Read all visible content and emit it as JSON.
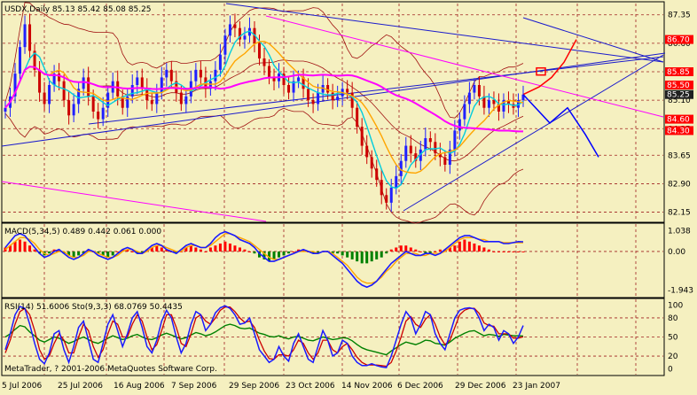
{
  "colors": {
    "chart_bg": "#f5f0c0",
    "bull": "#2020ff",
    "bear": "#cc0000",
    "ma_fast": "#00ccdd",
    "ma_mid": "#ffa500",
    "ma_slow": "#ff00ff",
    "band": "#a01010",
    "trend": "#1a1acc",
    "channel": "#ff00ff",
    "grid": "#a02020",
    "label_red_bg": "#ff0000",
    "label_white": "#ffffff",
    "macd_up": "#ff0000",
    "macd_down": "#008000",
    "rsi": "#008000",
    "stoch_main": "#1a1aff",
    "stoch_signal": "#cc0000",
    "arrows": "#ff0000",
    "arrows_alt": "#0000ff"
  },
  "chart_data": [
    {
      "type": "candlestick",
      "title": "USDX,Daily  85.13 85.42 85.08 85.25",
      "symbol": "USDX",
      "timeframe": "Daily",
      "ohlc_last": {
        "open": 85.13,
        "high": 85.42,
        "low": 85.08,
        "close": 85.25
      },
      "price_ticks": [
        "87.35",
        "86.60",
        "85.85",
        "85.10",
        "84.35",
        "83.65",
        "82.90",
        "82.15"
      ],
      "price_labels": [
        {
          "value": 86.7,
          "text": "86.70",
          "style": "red"
        },
        {
          "value": 85.85,
          "text": "85.85",
          "style": "red"
        },
        {
          "value": 85.5,
          "text": "85.50",
          "style": "red"
        },
        {
          "value": 85.25,
          "text": "85.25",
          "style": "dark"
        },
        {
          "value": 84.6,
          "text": "84.60",
          "style": "red"
        },
        {
          "value": 84.3,
          "text": "84.30",
          "style": "red"
        }
      ],
      "ylim": [
        82.0,
        87.6
      ],
      "date_labels": [
        "5 Jul 2006",
        "25 Jul 2006",
        "16 Aug 2006",
        "7 Sep 2006",
        "29 Sep 2006",
        "23 Oct 2006",
        "14 Nov 2006",
        "6 Dec 2006",
        "29 Dec 2006",
        "23 Jan 2007"
      ],
      "close_series_approx": [
        84.9,
        85.2,
        85.8,
        86.5,
        87.1,
        86.4,
        85.9,
        85.3,
        85.0,
        85.5,
        85.8,
        85.6,
        85.1,
        84.7,
        85.0,
        85.4,
        85.7,
        85.2,
        84.8,
        84.6,
        84.9,
        85.3,
        85.6,
        85.2,
        84.9,
        85.2,
        85.5,
        85.7,
        85.4,
        85.1,
        85.0,
        85.3,
        85.7,
        85.9,
        85.6,
        85.3,
        85.0,
        85.2,
        85.6,
        85.9,
        85.7,
        85.4,
        85.6,
        85.9,
        86.3,
        86.8,
        87.1,
        87.0,
        86.7,
        86.8,
        87.0,
        86.6,
        86.2,
        86.0,
        85.7,
        85.6,
        85.8,
        85.5,
        85.3,
        85.6,
        85.7,
        85.4,
        85.1,
        85.0,
        85.3,
        85.5,
        85.3,
        85.1,
        85.2,
        85.4,
        85.3,
        84.9,
        84.4,
        83.9,
        83.6,
        83.3,
        83.0,
        82.6,
        82.4,
        82.8,
        83.1,
        83.5,
        83.9,
        83.7,
        83.5,
        83.8,
        84.1,
        84.0,
        83.7,
        83.6,
        83.4,
        83.8,
        84.3,
        84.6,
        85.0,
        85.3,
        85.5,
        85.2,
        84.9,
        85.1,
        85.0,
        84.8,
        85.1,
        85.0,
        84.9,
        85.1,
        85.25
      ],
      "projection": [
        85.25,
        85.45,
        85.7,
        86.1,
        86.7
      ],
      "projection_alt": [
        85.25,
        84.5,
        84.9,
        84.2,
        83.6
      ]
    },
    {
      "type": "bar",
      "title": "MACD(5,34,5)  0.489 0.442 0.061 0.000",
      "y_ticks": [
        "1.038",
        "0.00",
        "-1.943"
      ],
      "ylim": [
        -2.15,
        1.25
      ],
      "histogram": [
        0.2,
        0.3,
        0.5,
        0.6,
        0.5,
        0.3,
        0.1,
        -0.1,
        -0.2,
        -0.1,
        0.1,
        0.1,
        -0.1,
        -0.2,
        -0.3,
        -0.2,
        -0.1,
        0.1,
        0.0,
        -0.1,
        -0.2,
        -0.3,
        -0.2,
        0.0,
        0.1,
        0.1,
        0.0,
        -0.1,
        -0.1,
        0.1,
        0.2,
        0.3,
        0.2,
        0.1,
        0.0,
        -0.1,
        0.0,
        0.2,
        0.3,
        0.2,
        0.1,
        0.0,
        0.2,
        0.3,
        0.4,
        0.5,
        0.4,
        0.3,
        0.2,
        0.1,
        0.0,
        -0.1,
        -0.3,
        -0.4,
        -0.5,
        -0.4,
        -0.3,
        -0.2,
        -0.1,
        0.0,
        0.1,
        0.1,
        0.0,
        -0.1,
        -0.1,
        0.0,
        0.0,
        -0.1,
        -0.1,
        -0.2,
        -0.3,
        -0.4,
        -0.5,
        -0.6,
        -0.6,
        -0.5,
        -0.4,
        -0.3,
        -0.1,
        0.1,
        0.2,
        0.3,
        0.3,
        0.2,
        0.1,
        0.0,
        -0.1,
        -0.1,
        0.0,
        0.1,
        0.1,
        0.2,
        0.3,
        0.5,
        0.6,
        0.5,
        0.4,
        0.3,
        0.2,
        0.1,
        0.0,
        0.0,
        0.0,
        0.0,
        0.0,
        0.0,
        0.0
      ],
      "macd_line": [
        0.2,
        0.5,
        0.8,
        0.9,
        0.8,
        0.5,
        0.2,
        -0.1,
        -0.3,
        -0.2,
        0.0,
        0.1,
        -0.1,
        -0.3,
        -0.4,
        -0.3,
        -0.1,
        0.1,
        0.0,
        -0.2,
        -0.3,
        -0.4,
        -0.3,
        -0.1,
        0.1,
        0.2,
        0.1,
        -0.1,
        -0.1,
        0.1,
        0.3,
        0.4,
        0.3,
        0.1,
        0.0,
        -0.1,
        0.1,
        0.3,
        0.4,
        0.3,
        0.2,
        0.2,
        0.4,
        0.7,
        0.9,
        1.0,
        0.9,
        0.8,
        0.6,
        0.5,
        0.4,
        0.2,
        -0.1,
        -0.3,
        -0.5,
        -0.5,
        -0.4,
        -0.3,
        -0.2,
        -0.1,
        0.0,
        0.1,
        0.0,
        -0.1,
        -0.1,
        0.0,
        0.0,
        -0.2,
        -0.4,
        -0.6,
        -0.9,
        -1.2,
        -1.5,
        -1.7,
        -1.8,
        -1.7,
        -1.5,
        -1.2,
        -0.9,
        -0.6,
        -0.4,
        -0.2,
        0.0,
        -0.1,
        -0.2,
        -0.2,
        -0.1,
        -0.1,
        -0.2,
        -0.1,
        0.1,
        0.3,
        0.5,
        0.7,
        0.8,
        0.8,
        0.7,
        0.6,
        0.5,
        0.5,
        0.5,
        0.5,
        0.4,
        0.4,
        0.45,
        0.5,
        0.489
      ],
      "signal_line": [
        0.1,
        0.3,
        0.5,
        0.7,
        0.7,
        0.6,
        0.4,
        0.1,
        -0.1,
        -0.2,
        -0.1,
        0.0,
        0.0,
        -0.2,
        -0.3,
        -0.3,
        -0.2,
        0.0,
        0.0,
        -0.1,
        -0.2,
        -0.3,
        -0.3,
        -0.2,
        0.0,
        0.1,
        0.1,
        0.0,
        -0.1,
        0.0,
        0.2,
        0.3,
        0.3,
        0.2,
        0.1,
        0.0,
        0.0,
        0.2,
        0.3,
        0.3,
        0.2,
        0.2,
        0.3,
        0.5,
        0.7,
        0.9,
        0.9,
        0.8,
        0.7,
        0.6,
        0.5,
        0.3,
        0.1,
        -0.1,
        -0.3,
        -0.4,
        -0.4,
        -0.3,
        -0.2,
        -0.1,
        0.0,
        0.0,
        0.0,
        0.0,
        -0.1,
        0.0,
        0.0,
        -0.1,
        -0.3,
        -0.5,
        -0.7,
        -1.0,
        -1.3,
        -1.5,
        -1.6,
        -1.6,
        -1.5,
        -1.3,
        -1.0,
        -0.8,
        -0.5,
        -0.3,
        -0.1,
        -0.1,
        -0.1,
        -0.2,
        -0.2,
        -0.1,
        -0.1,
        -0.1,
        0.0,
        0.2,
        0.4,
        0.6,
        0.7,
        0.7,
        0.7,
        0.6,
        0.6,
        0.5,
        0.5,
        0.5,
        0.45,
        0.45,
        0.44,
        0.44,
        0.442
      ]
    },
    {
      "type": "line",
      "title": "RSI(14) 51.6006  Sto(9,3,3) 68.0769 50.4435",
      "y_ticks": [
        "100",
        "80",
        "50",
        "20",
        "0"
      ],
      "ylim": [
        -5,
        105
      ],
      "rsi": [
        50,
        55,
        62,
        68,
        66,
        58,
        52,
        45,
        42,
        46,
        50,
        48,
        44,
        40,
        43,
        47,
        50,
        46,
        42,
        40,
        44,
        48,
        52,
        49,
        46,
        48,
        52,
        54,
        50,
        47,
        46,
        49,
        53,
        56,
        53,
        50,
        47,
        49,
        53,
        57,
        55,
        52,
        54,
        58,
        63,
        68,
        70,
        68,
        64,
        63,
        64,
        60,
        56,
        54,
        51,
        50,
        52,
        49,
        47,
        50,
        51,
        48,
        45,
        44,
        47,
        50,
        48,
        46,
        47,
        49,
        48,
        44,
        38,
        33,
        30,
        28,
        26,
        24,
        22,
        28,
        33,
        38,
        42,
        40,
        38,
        41,
        45,
        44,
        40,
        39,
        37,
        42,
        48,
        52,
        56,
        59,
        60,
        56,
        52,
        54,
        53,
        51,
        54,
        53,
        52,
        52,
        51.6
      ],
      "stoch_main": [
        30,
        55,
        85,
        98,
        95,
        70,
        40,
        15,
        8,
        25,
        55,
        60,
        30,
        10,
        35,
        65,
        75,
        45,
        15,
        10,
        40,
        70,
        85,
        60,
        35,
        55,
        80,
        90,
        65,
        35,
        25,
        45,
        75,
        92,
        80,
        50,
        25,
        40,
        70,
        90,
        85,
        60,
        70,
        88,
        96,
        99,
        95,
        85,
        70,
        72,
        80,
        55,
        30,
        20,
        10,
        15,
        35,
        20,
        12,
        40,
        55,
        35,
        15,
        10,
        35,
        60,
        45,
        20,
        25,
        45,
        40,
        20,
        10,
        5,
        5,
        8,
        5,
        3,
        2,
        20,
        45,
        70,
        90,
        80,
        55,
        70,
        90,
        85,
        55,
        40,
        30,
        55,
        80,
        92,
        95,
        96,
        94,
        80,
        60,
        70,
        65,
        45,
        60,
        55,
        40,
        50,
        68
      ],
      "stoch_signal": [
        25,
        45,
        70,
        90,
        95,
        85,
        60,
        30,
        15,
        20,
        40,
        55,
        45,
        25,
        25,
        50,
        70,
        60,
        35,
        18,
        30,
        55,
        75,
        70,
        50,
        50,
        70,
        85,
        75,
        50,
        30,
        38,
        60,
        85,
        85,
        65,
        40,
        35,
        55,
        80,
        85,
        75,
        70,
        80,
        92,
        97,
        97,
        90,
        80,
        73,
        75,
        65,
        45,
        28,
        16,
        15,
        22,
        22,
        20,
        30,
        45,
        40,
        25,
        15,
        25,
        45,
        45,
        30,
        25,
        35,
        40,
        30,
        18,
        10,
        6,
        6,
        6,
        5,
        4,
        10,
        28,
        50,
        75,
        82,
        70,
        65,
        78,
        85,
        70,
        50,
        38,
        45,
        65,
        85,
        92,
        95,
        95,
        87,
        72,
        68,
        67,
        55,
        55,
        55,
        48,
        48,
        50.4
      ]
    }
  ],
  "footer": "MetaTrader, ? 2001-2006 MetaQuotes Software Corp."
}
